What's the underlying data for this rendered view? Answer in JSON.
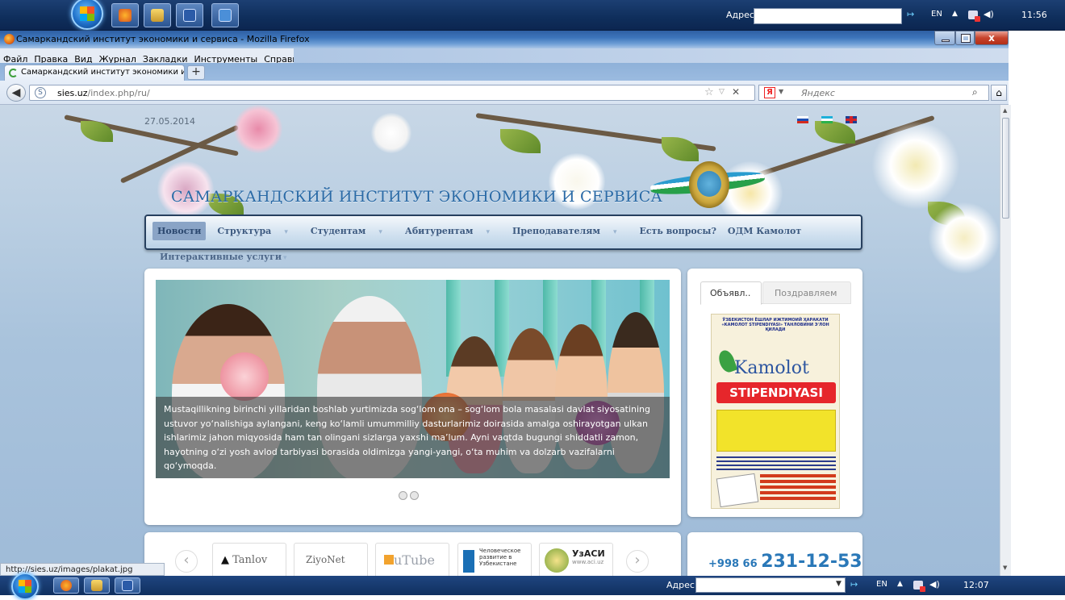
{
  "taskbar_top": {
    "address_label": "Адрес",
    "lang": "EN",
    "clock": "11:56"
  },
  "window": {
    "title": "Самаркандский институт экономики и сервиса - Mozilla Firefox"
  },
  "menubar": {
    "items": [
      "Файл",
      "Правка",
      "Вид",
      "Журнал",
      "Закладки",
      "Инструменты",
      "Справка"
    ]
  },
  "tabs": {
    "active_tab": "Самаркандский институт экономики и...",
    "new_tab": "+"
  },
  "navigation": {
    "url_host": "sies.uz",
    "url_path": "/index.php/ru/",
    "search_placeholder": "Яндекс"
  },
  "site": {
    "date": "27.05.2014",
    "title": "САМАРКАНДСКИЙ ИНСТИТУТ ЭКОНОМИКИ И СЕРВИСА",
    "menu": [
      {
        "label": "Новости",
        "active": true
      },
      {
        "label": "Структура",
        "has_sub": true
      },
      {
        "label": "Студентам",
        "has_sub": true
      },
      {
        "label": "Абитурентам",
        "has_sub": true
      },
      {
        "label": "Преподавателям",
        "has_sub": true
      },
      {
        "label": "Есть вопросы?"
      },
      {
        "label": "ОДМ Камолот"
      }
    ],
    "menu_row2": "Интерактивные услуги",
    "slider": {
      "caption": "Mustaqillikning birinchi yillaridan boshlab yurtimizda sog‘lom ona – sog‘lom bola masalasi davlat siyosatining ustuvor yo‘nalishiga aylangani, keng ko‘lamli umummilliy dasturlarimiz doirasida amalga oshirayotgan ulkan ishlarimiz jahon miqyosida ham tan olingani sizlarga yaxshi ma’lum. Ayni vaqtda bugungi shiddatli zamon, hayotning o‘zi yosh avlod tarbiyasi borasida oldimizga yangi-yangi, o‘ta muhim va dolzarb vazifalarni qo‘ymoqda."
    },
    "side_tabs": [
      "Объявл..",
      "Поздравляем"
    ],
    "poster": {
      "header": "ЎЗБЕКИСТОН ЁШЛАР ИЖТИМОИЙ ҲАРАКАТИ «КАМОЛОТ STIPENDIYASI» ТАНЛОВИНИ Э'ЛОН ҚИЛАДИ",
      "logo": "Kamolot",
      "stipend": "STIPENDIYASI"
    },
    "partners": [
      "Tanlov",
      "ZiyoNet",
      "uTube",
      "Человеческое развитие в Узбекистане",
      "УзАСИ",
      "www.aci.uz"
    ],
    "phone_prefix": "+998 66",
    "phone_number": "231-12-53"
  },
  "statusbar": {
    "text": "http://sies.uz/images/plakat.jpg"
  },
  "taskbar_bottom": {
    "address_label": "Адрес",
    "lang": "EN",
    "clock": "12:07"
  }
}
